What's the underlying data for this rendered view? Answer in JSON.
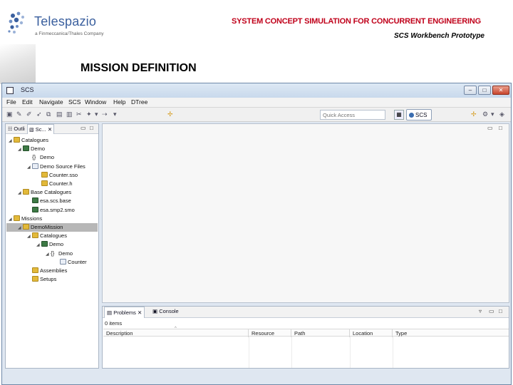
{
  "header": {
    "logo_name": "Telespazio",
    "logo_sub": "a Finmeccanica/Thales Company",
    "slide_title": "SYSTEM CONCEPT SIMULATION FOR CONCURRENT ENGINEERING",
    "slide_subtitle": "SCS Workbench Prototype",
    "section_title": "MISSION DEFINITION"
  },
  "window": {
    "title": "SCS",
    "buttons": {
      "minimize": "–",
      "maximize": "□",
      "close": "✕"
    }
  },
  "menu": [
    "File",
    "Edit",
    "Navigate",
    "SCS",
    "Window",
    "Help",
    "DTree"
  ],
  "toolbar": {
    "quick_access_placeholder": "Quick Access",
    "perspective": "SCS"
  },
  "left_panel": {
    "tabs": [
      "Outli",
      "Sc..."
    ],
    "tree": [
      {
        "label": "Catalogues",
        "level": 0,
        "icon": "folder",
        "expanded": true
      },
      {
        "label": "Demo",
        "level": 1,
        "icon": "db",
        "expanded": true
      },
      {
        "label": "Demo",
        "level": 2,
        "icon": "brace",
        "expanded": null
      },
      {
        "label": "Demo Source Files",
        "level": 2,
        "icon": "file",
        "expanded": true
      },
      {
        "label": "Counter.sso",
        "level": 3,
        "icon": "folder",
        "expanded": null
      },
      {
        "label": "Counter.h",
        "level": 3,
        "icon": "folder",
        "expanded": null
      },
      {
        "label": "Base Catalogues",
        "level": 1,
        "icon": "folder",
        "expanded": true
      },
      {
        "label": "esa.scs.base",
        "level": 2,
        "icon": "db",
        "expanded": null
      },
      {
        "label": "esa.smp2.smo",
        "level": 2,
        "icon": "db",
        "expanded": null
      },
      {
        "label": "Missions",
        "level": 0,
        "icon": "folder",
        "expanded": true
      },
      {
        "label": "DemoMission",
        "level": 1,
        "icon": "mission",
        "expanded": true,
        "selected": true
      },
      {
        "label": "Catalogues",
        "level": 2,
        "icon": "folder",
        "expanded": true
      },
      {
        "label": "Demo",
        "level": 3,
        "icon": "db",
        "expanded": true
      },
      {
        "label": "Demo",
        "level": 4,
        "icon": "brace",
        "expanded": true
      },
      {
        "label": "Counter",
        "level": 5,
        "icon": "file",
        "expanded": null
      },
      {
        "label": "Assemblies",
        "level": 2,
        "icon": "folder",
        "expanded": null
      },
      {
        "label": "Setups",
        "level": 2,
        "icon": "folder",
        "expanded": null
      }
    ]
  },
  "bottom_panel": {
    "tabs": [
      "Problems",
      "Console"
    ],
    "items_count": "0 items",
    "columns": [
      "Description",
      "Resource",
      "Path",
      "Location",
      "Type"
    ]
  }
}
